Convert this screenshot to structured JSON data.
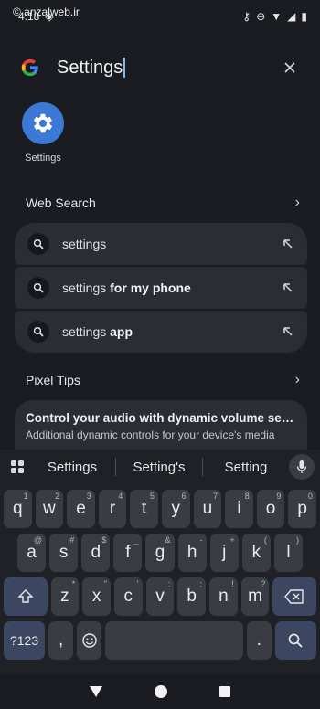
{
  "status_bar": {
    "time": "4:18",
    "watermark": "© anzalweb.ir"
  },
  "search": {
    "query": "Settings"
  },
  "app_result": {
    "label": "Settings"
  },
  "web_search": {
    "header": "Web Search",
    "suggestions": [
      {
        "prefix": "settings",
        "suffix": ""
      },
      {
        "prefix": "settings",
        "suffix": " for my phone"
      },
      {
        "prefix": "settings",
        "suffix": " app"
      }
    ]
  },
  "pixel_tips": {
    "header": "Pixel Tips",
    "card_title": "Control your audio with dynamic volume setti...",
    "card_subtitle": "Additional dynamic controls for your device's media"
  },
  "keyboard": {
    "suggestions": [
      "Settings",
      "Setting's",
      "Setting"
    ],
    "row1": [
      {
        "k": "q",
        "h": "1"
      },
      {
        "k": "w",
        "h": "2"
      },
      {
        "k": "e",
        "h": "3"
      },
      {
        "k": "r",
        "h": "4"
      },
      {
        "k": "t",
        "h": "5"
      },
      {
        "k": "y",
        "h": "6"
      },
      {
        "k": "u",
        "h": "7"
      },
      {
        "k": "i",
        "h": "8"
      },
      {
        "k": "o",
        "h": "9"
      },
      {
        "k": "p",
        "h": "0"
      }
    ],
    "row2": [
      {
        "k": "a",
        "h": "@"
      },
      {
        "k": "s",
        "h": "#"
      },
      {
        "k": "d",
        "h": "$"
      },
      {
        "k": "f",
        "h": "_"
      },
      {
        "k": "g",
        "h": "&"
      },
      {
        "k": "h",
        "h": "-"
      },
      {
        "k": "j",
        "h": "+"
      },
      {
        "k": "k",
        "h": "("
      },
      {
        "k": "l",
        "h": ")"
      }
    ],
    "row3": [
      {
        "k": "z",
        "h": "*"
      },
      {
        "k": "x",
        "h": "\""
      },
      {
        "k": "c",
        "h": "'"
      },
      {
        "k": "v",
        "h": ":"
      },
      {
        "k": "b",
        "h": ";"
      },
      {
        "k": "n",
        "h": "!"
      },
      {
        "k": "m",
        "h": "?"
      }
    ],
    "symbols_label": "?123",
    "comma_label": ",",
    "period_label": "."
  }
}
